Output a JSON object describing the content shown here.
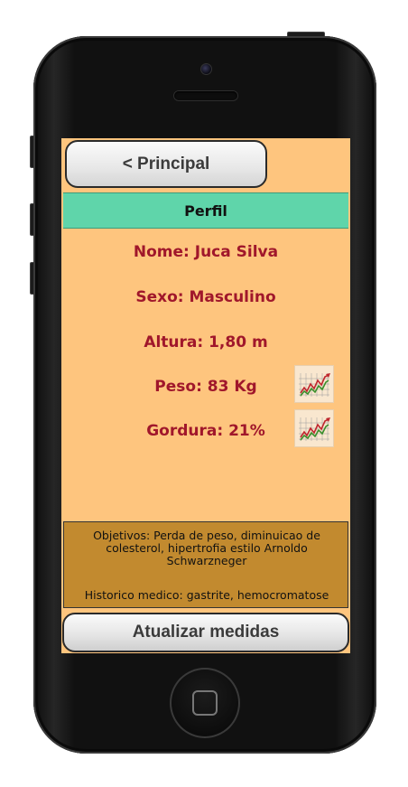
{
  "nav": {
    "back_label": "< Principal"
  },
  "header": {
    "title": "Perfil"
  },
  "profile": {
    "name": "Nome: Juca Silva",
    "sex": "Sexo: Masculino",
    "height": "Altura: 1,80 m",
    "weight": "Peso: 83 Kg",
    "body_fat": "Gordura: 21%"
  },
  "icons": {
    "weight_trend": "line-chart-icon",
    "fat_trend": "line-chart-icon"
  },
  "notes": {
    "objectives": "Objetivos: Perda de peso, diminuicao de colesterol, hipertrofia estilo Arnoldo Schwarzneger",
    "history": "Historico medico: gastrite, hemocromatose"
  },
  "actions": {
    "update_label": "Atualizar medidas"
  },
  "colors": {
    "screen_bg": "#fec57e",
    "header_bg": "#5fd5aa",
    "text_accent": "#a0172b",
    "notes_bg": "#c28a2f"
  }
}
